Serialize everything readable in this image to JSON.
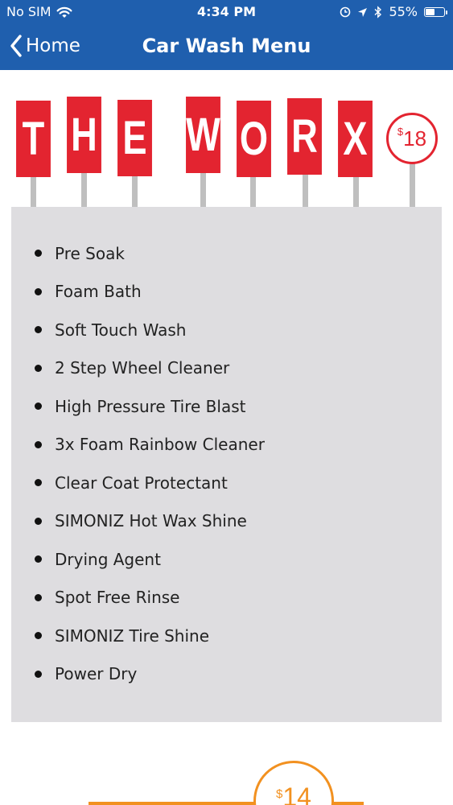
{
  "status_bar": {
    "carrier": "No SIM",
    "time": "4:34 PM",
    "battery_percent": "55%",
    "battery_level": 0.55,
    "icons": [
      "wifi-icon",
      "alarm-icon",
      "location-arrow-icon",
      "bluetooth-icon",
      "battery-icon"
    ]
  },
  "nav": {
    "back_label": "Home",
    "title": "Car Wash Menu"
  },
  "package": {
    "name_letters": [
      "T",
      "H",
      "E",
      "W",
      "O",
      "R",
      "X"
    ],
    "price_symbol": "$",
    "price": "18",
    "colors": {
      "sign": "#e32430",
      "panel": "#dedde0",
      "post": "#bfbfbf"
    },
    "features": [
      "Pre Soak",
      "Foam Bath",
      "Soft Touch Wash",
      "2 Step Wheel Cleaner",
      "High Pressure Tire Blast",
      "3x Foam Rainbow Cleaner",
      "Clear Coat Protectant",
      "SIMONIZ Hot Wax Shine",
      "Drying Agent",
      "Spot Free Rinse",
      "SIMONIZ Tire Shine",
      "Power Dry"
    ]
  },
  "next_package": {
    "price_symbol": "$",
    "price": "14",
    "color": "#f29120"
  },
  "colors": {
    "header": "#1f5fae"
  }
}
